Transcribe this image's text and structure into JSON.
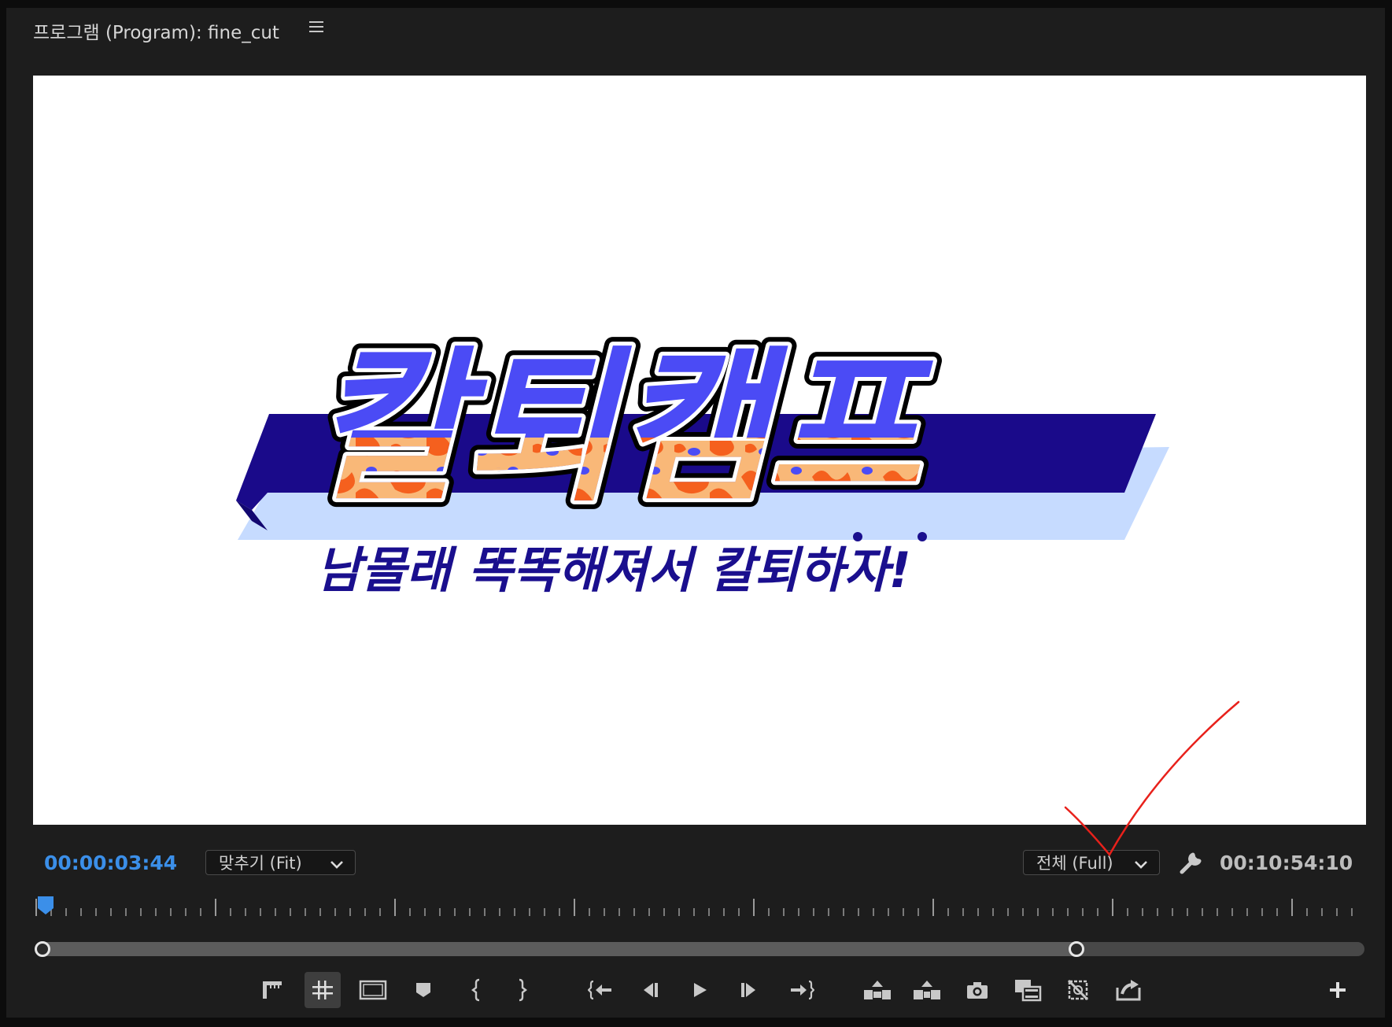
{
  "panel": {
    "title": "프로그램 (Program): fine_cut",
    "menu_icon": "hamburger-menu-icon"
  },
  "monitor": {
    "logo_text": "칼퇴캠프",
    "tagline": "남몰래 똑똑해져서 칼퇴하자!",
    "colors": {
      "logo_fill": "#4b4bf5",
      "banner_dark": "#1a0a8a",
      "banner_light": "#c6dbff",
      "flame_orange": "#f5601e",
      "flame_peach": "#f9b878",
      "tagline": "#1a0f8e"
    }
  },
  "controls_bar": {
    "current_timecode": "00:00:03:44",
    "zoom_label": "맞추기 (Fit)",
    "resolution_label": "전체 (Full)",
    "duration_timecode": "00:10:54:10",
    "settings_icon": "wrench-icon"
  },
  "transport": [
    {
      "name": "mark-button",
      "icon": "marker-ruler-icon"
    },
    {
      "name": "safe-margins-button",
      "icon": "grid-icon",
      "active": true
    },
    {
      "name": "frame-button",
      "icon": "frame-icon"
    },
    {
      "name": "add-marker-button",
      "icon": "marker-icon"
    },
    {
      "name": "mark-in-button",
      "icon": "mark-in-icon"
    },
    {
      "name": "mark-out-button",
      "icon": "mark-out-icon"
    },
    {
      "name": "go-to-in-button",
      "icon": "go-to-in-icon"
    },
    {
      "name": "step-back-button",
      "icon": "step-back-icon"
    },
    {
      "name": "play-button",
      "icon": "play-icon"
    },
    {
      "name": "step-forward-button",
      "icon": "step-forward-icon"
    },
    {
      "name": "go-to-out-button",
      "icon": "go-to-out-icon"
    },
    {
      "name": "lift-button",
      "icon": "lift-icon"
    },
    {
      "name": "extract-button",
      "icon": "extract-icon"
    },
    {
      "name": "export-frame-button",
      "icon": "camera-icon"
    },
    {
      "name": "compare-view-button",
      "icon": "compare-icon"
    },
    {
      "name": "toggle-proxies-button",
      "icon": "proxy-icon"
    },
    {
      "name": "share-button",
      "icon": "share-icon"
    },
    {
      "name": "button-editor-button",
      "icon": "plus-icon"
    }
  ],
  "annotation": {
    "color": "#e8211b"
  }
}
